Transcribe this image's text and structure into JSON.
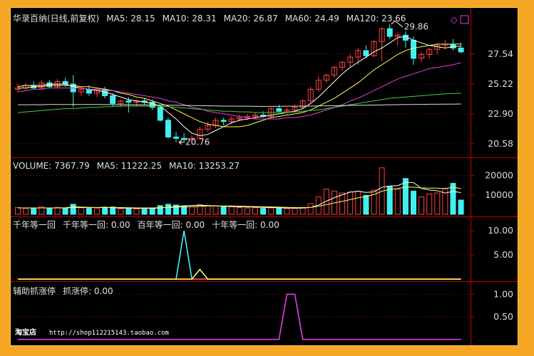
{
  "colors": {
    "up": "#ff4040",
    "down": "#40f0f0",
    "white": "#ffffff",
    "yellow": "#ffff50",
    "magenta": "#e040e0",
    "green": "#40d040",
    "grid": "#a00000",
    "axis": "#c00000",
    "header": "#e0e0e0"
  },
  "header": {
    "main": [
      {
        "text": "华录百纳(日线,前复权)",
        "color": "#e0e0e0"
      },
      {
        "text": "MA5: 28.15",
        "color": "#ffffff"
      },
      {
        "text": "MA10: 28.31",
        "color": "#ffff50"
      },
      {
        "text": "MA20: 26.87",
        "color": "#e040e0"
      },
      {
        "text": "MA60: 24.49",
        "color": "#40d040"
      },
      {
        "text": "MA120: 23.66",
        "color": "#e0e0e0"
      }
    ],
    "volume": [
      {
        "text": "VOLUME: 7367.79",
        "color": "#e0e0e0"
      },
      {
        "text": "MA5: 11222.25",
        "color": "#e0e0e0"
      },
      {
        "text": "MA10: 13253.27",
        "color": "#e0e0e0"
      }
    ],
    "ind1": [
      {
        "text": "千年等一回",
        "color": "#e0e0e0"
      },
      {
        "text": "千年等一回: 0.00",
        "color": "#40f0f0"
      },
      {
        "text": "百年等一回: 0.00",
        "color": "#ff4040"
      },
      {
        "text": "十年等一回: 0.00",
        "color": "#ffff50"
      }
    ],
    "ind2": [
      {
        "text": "辅助抓涨停",
        "color": "#e0e0e0"
      },
      {
        "text": "抓涨停: 0.00",
        "color": "#e040e0"
      }
    ]
  },
  "annotations": {
    "high": "29.86",
    "low": "20.76"
  },
  "watermark": {
    "shop": "淘宝店",
    "url": "http://shop112215143.taobao.com"
  },
  "chart_data": [
    {
      "type": "candlestick",
      "title": "华录百纳(日线,前复权)",
      "y_ticks": [
        27.54,
        25.22,
        22.9,
        20.58
      ],
      "ylim": [
        19.8,
        29.9
      ],
      "ohlc": [
        [
          24.8,
          25.2,
          24.6,
          24.9
        ],
        [
          24.9,
          25.3,
          24.7,
          25.1
        ],
        [
          25.1,
          25.4,
          24.8,
          24.9
        ],
        [
          24.9,
          25.5,
          24.8,
          25.3
        ],
        [
          25.3,
          25.5,
          24.9,
          25.0
        ],
        [
          25.0,
          25.6,
          24.9,
          25.4
        ],
        [
          25.4,
          25.7,
          25.0,
          25.2
        ],
        [
          25.2,
          25.9,
          23.4,
          24.6
        ],
        [
          24.6,
          25.0,
          24.3,
          24.8
        ],
        [
          24.8,
          25.1,
          24.3,
          24.5
        ],
        [
          24.5,
          24.9,
          24.2,
          24.8
        ],
        [
          24.8,
          25.0,
          24.1,
          24.3
        ],
        [
          24.3,
          24.5,
          23.5,
          23.7
        ],
        [
          23.7,
          24.0,
          23.4,
          23.9
        ],
        [
          23.9,
          24.2,
          23.0,
          23.8
        ],
        [
          23.8,
          24.0,
          23.5,
          23.9
        ],
        [
          23.9,
          24.1,
          23.6,
          23.8
        ],
        [
          23.8,
          24.0,
          23.2,
          23.4
        ],
        [
          23.4,
          23.6,
          22.3,
          22.4
        ],
        [
          22.4,
          22.6,
          21.0,
          21.1
        ],
        [
          21.1,
          21.5,
          20.7,
          21.0
        ],
        [
          21.0,
          21.4,
          20.76,
          20.9
        ],
        [
          20.9,
          21.2,
          20.8,
          21.0
        ],
        [
          21.0,
          21.9,
          20.9,
          21.7
        ],
        [
          21.7,
          22.3,
          21.5,
          22.0
        ],
        [
          22.0,
          22.6,
          21.8,
          22.4
        ],
        [
          22.4,
          22.6,
          22.0,
          22.3
        ],
        [
          22.3,
          22.7,
          22.1,
          22.5
        ],
        [
          22.5,
          22.8,
          22.3,
          22.6
        ],
        [
          22.6,
          22.9,
          22.4,
          22.7
        ],
        [
          22.7,
          23.0,
          22.5,
          22.8
        ],
        [
          22.8,
          23.1,
          22.6,
          22.7
        ],
        [
          22.7,
          23.4,
          22.6,
          23.3
        ],
        [
          23.3,
          23.6,
          23.0,
          23.1
        ],
        [
          23.1,
          23.4,
          22.9,
          23.2
        ],
        [
          23.2,
          23.6,
          23.0,
          23.4
        ],
        [
          23.4,
          24.0,
          23.3,
          23.9
        ],
        [
          23.9,
          25.0,
          23.8,
          24.8
        ],
        [
          24.8,
          25.8,
          24.6,
          25.5
        ],
        [
          25.5,
          26.0,
          25.3,
          25.9
        ],
        [
          25.9,
          26.6,
          25.7,
          26.5
        ],
        [
          26.5,
          27.0,
          26.2,
          26.9
        ],
        [
          26.9,
          27.5,
          26.5,
          27.3
        ],
        [
          27.3,
          28.0,
          26.7,
          27.8
        ],
        [
          27.8,
          28.2,
          27.2,
          27.4
        ],
        [
          27.4,
          28.6,
          27.3,
          28.5
        ],
        [
          28.5,
          29.6,
          27.0,
          29.5
        ],
        [
          29.5,
          29.86,
          28.7,
          28.9
        ],
        [
          28.9,
          29.2,
          28.2,
          29.0
        ],
        [
          29.0,
          29.3,
          28.0,
          28.6
        ],
        [
          28.6,
          28.9,
          26.7,
          27.2
        ],
        [
          27.2,
          27.7,
          26.9,
          27.5
        ],
        [
          27.5,
          28.0,
          27.2,
          27.9
        ],
        [
          27.9,
          28.4,
          27.5,
          28.2
        ],
        [
          28.2,
          28.6,
          27.9,
          28.3
        ],
        [
          28.3,
          28.7,
          27.8,
          28.0
        ],
        [
          28.0,
          28.4,
          27.6,
          27.7
        ]
      ],
      "ma_series": [
        {
          "name": "MA5",
          "color": "#ffffff",
          "values": [
            25.0,
            25.1,
            25.1,
            25.1,
            25.2,
            25.2,
            25.2,
            25.0,
            24.9,
            24.8,
            24.7,
            24.6,
            24.4,
            24.2,
            24.0,
            23.9,
            23.8,
            23.7,
            23.5,
            23.0,
            22.5,
            21.9,
            21.4,
            21.2,
            21.3,
            21.6,
            21.9,
            22.2,
            22.4,
            22.5,
            22.6,
            22.7,
            22.8,
            22.9,
            23.0,
            23.1,
            23.3,
            23.7,
            24.2,
            24.8,
            25.4,
            26.0,
            26.5,
            26.9,
            27.3,
            27.7,
            28.0,
            28.4,
            28.8,
            28.9,
            28.6,
            28.4,
            28.2,
            28.1,
            28.0,
            28.1,
            28.15
          ]
        },
        {
          "name": "MA10",
          "color": "#ffff50",
          "values": [
            24.9,
            24.9,
            25.0,
            25.0,
            25.1,
            25.1,
            25.1,
            25.1,
            25.0,
            25.0,
            24.9,
            24.8,
            24.7,
            24.5,
            24.4,
            24.2,
            24.1,
            23.9,
            23.7,
            23.5,
            23.2,
            22.9,
            22.6,
            22.3,
            22.1,
            22.0,
            21.9,
            21.9,
            21.9,
            22.0,
            22.2,
            22.4,
            22.6,
            22.7,
            22.8,
            22.9,
            23.0,
            23.2,
            23.5,
            23.8,
            24.1,
            24.5,
            24.9,
            25.3,
            25.8,
            26.3,
            26.7,
            27.1,
            27.5,
            27.8,
            28.0,
            28.1,
            28.2,
            28.3,
            28.3,
            28.3,
            28.31
          ]
        },
        {
          "name": "MA20",
          "color": "#e040e0",
          "values": [
            24.6,
            24.7,
            24.8,
            24.8,
            24.9,
            24.9,
            24.9,
            24.9,
            24.9,
            24.8,
            24.8,
            24.7,
            24.7,
            24.6,
            24.5,
            24.4,
            24.3,
            24.2,
            24.1,
            23.9,
            23.8,
            23.6,
            23.4,
            23.3,
            23.1,
            23.0,
            22.9,
            22.8,
            22.7,
            22.6,
            22.5,
            22.5,
            22.5,
            22.5,
            22.6,
            22.6,
            22.7,
            22.8,
            23.0,
            23.2,
            23.4,
            23.6,
            23.9,
            24.1,
            24.4,
            24.7,
            25.0,
            25.3,
            25.6,
            25.8,
            26.0,
            26.2,
            26.4,
            26.5,
            26.6,
            26.7,
            26.87
          ]
        },
        {
          "name": "MA60",
          "color": "#40d040",
          "values": [
            23.0,
            23.05,
            23.1,
            23.15,
            23.2,
            23.25,
            23.3,
            23.3,
            23.35,
            23.4,
            23.4,
            23.45,
            23.45,
            23.5,
            23.5,
            23.5,
            23.5,
            23.5,
            23.5,
            23.45,
            23.4,
            23.35,
            23.3,
            23.25,
            23.2,
            23.15,
            23.1,
            23.1,
            23.05,
            23.05,
            23.0,
            23.0,
            23.0,
            23.0,
            23.0,
            23.05,
            23.1,
            23.15,
            23.2,
            23.3,
            23.4,
            23.5,
            23.6,
            23.7,
            23.8,
            23.9,
            24.0,
            24.1,
            24.15,
            24.2,
            24.25,
            24.3,
            24.35,
            24.4,
            24.45,
            24.47,
            24.49
          ]
        },
        {
          "name": "MA120",
          "color": "#e0e0e0",
          "values": [
            23.6,
            23.6,
            23.61,
            23.61,
            23.62,
            23.62,
            23.62,
            23.62,
            23.62,
            23.62,
            23.62,
            23.62,
            23.61,
            23.61,
            23.6,
            23.6,
            23.59,
            23.58,
            23.58,
            23.57,
            23.56,
            23.55,
            23.54,
            23.53,
            23.52,
            23.51,
            23.5,
            23.5,
            23.49,
            23.49,
            23.48,
            23.48,
            23.48,
            23.48,
            23.49,
            23.49,
            23.5,
            23.5,
            23.51,
            23.52,
            23.53,
            23.54,
            23.55,
            23.56,
            23.57,
            23.58,
            23.59,
            23.6,
            23.61,
            23.62,
            23.62,
            23.63,
            23.64,
            23.64,
            23.65,
            23.65,
            23.66
          ]
        }
      ]
    },
    {
      "type": "bar",
      "title": "VOLUME",
      "y_ticks": [
        20000,
        10000
      ],
      "ylim": [
        0,
        25000
      ],
      "values": [
        3500,
        3000,
        3200,
        3800,
        3000,
        3600,
        3200,
        5200,
        3400,
        3100,
        3000,
        3300,
        3800,
        2900,
        3100,
        2800,
        2700,
        3200,
        4500,
        5200,
        4800,
        4200,
        4000,
        5000,
        4600,
        4300,
        4100,
        3900,
        3500,
        3300,
        3400,
        3100,
        3300,
        3200,
        3000,
        3100,
        3600,
        5500,
        9000,
        13000,
        12000,
        11000,
        11500,
        12000,
        9800,
        12500,
        24000,
        14500,
        13000,
        18500,
        12000,
        9000,
        10500,
        11000,
        13500,
        16000,
        7367.79
      ],
      "ma_series": [
        {
          "name": "MA5",
          "color": "#ffffff",
          "values": [
            3300,
            3300,
            3300,
            3300,
            3300,
            3300,
            3400,
            3800,
            3700,
            3600,
            3500,
            3700,
            3400,
            3200,
            3200,
            3100,
            3100,
            3100,
            3300,
            3700,
            4100,
            4400,
            4600,
            4700,
            4500,
            4400,
            4200,
            4000,
            3900,
            3800,
            3700,
            3600,
            3500,
            3400,
            3200,
            3200,
            3200,
            3600,
            4800,
            6800,
            8600,
            10100,
            11500,
            11900,
            11300,
            11600,
            14000,
            14600,
            14800,
            16500,
            16400,
            13400,
            12500,
            12200,
            11000,
            11800,
            11222.25
          ]
        },
        {
          "name": "MA10",
          "color": "#ffff50",
          "values": [
            3300,
            3300,
            3300,
            3300,
            3300,
            3300,
            3300,
            3500,
            3500,
            3500,
            3500,
            3500,
            3500,
            3500,
            3400,
            3300,
            3300,
            3300,
            3400,
            3500,
            3700,
            3800,
            3900,
            4100,
            4300,
            4300,
            4300,
            4300,
            4200,
            4100,
            4000,
            3900,
            3800,
            3700,
            3600,
            3500,
            3400,
            3600,
            4200,
            5000,
            5900,
            6700,
            7600,
            8500,
            9100,
            10200,
            11900,
            12900,
            13300,
            14100,
            14000,
            13600,
            13500,
            13500,
            13200,
            14000,
            13253.27
          ]
        }
      ]
    },
    {
      "type": "line",
      "title": "千年等一回",
      "y_ticks": [
        10.0,
        5.0
      ],
      "ylim": [
        0,
        11.5
      ],
      "series": [
        {
          "name": "千年等一回",
          "color": "#40f0f0",
          "points": [
            [
              0,
              0
            ],
            [
              20,
              0
            ],
            [
              21,
              10
            ],
            [
              22,
              0
            ],
            [
              56,
              0
            ]
          ]
        },
        {
          "name": "百年等一回",
          "color": "#ff4040",
          "points": [
            [
              0,
              0
            ],
            [
              56,
              0
            ]
          ]
        },
        {
          "name": "十年等一回",
          "color": "#ffff50",
          "points": [
            [
              0,
              0
            ],
            [
              22,
              0
            ],
            [
              23,
              2
            ],
            [
              24,
              0
            ],
            [
              56,
              0
            ]
          ]
        }
      ]
    },
    {
      "type": "line",
      "title": "辅助抓涨停",
      "y_ticks": [
        1.0,
        0.5
      ],
      "ylim": [
        -0.1,
        1.1
      ],
      "series": [
        {
          "name": "抓涨停",
          "color": "#e040e0",
          "points": [
            [
              0,
              0
            ],
            [
              33,
              0
            ],
            [
              34,
              1
            ],
            [
              35,
              1
            ],
            [
              36,
              0
            ],
            [
              56,
              0
            ]
          ]
        }
      ]
    }
  ]
}
